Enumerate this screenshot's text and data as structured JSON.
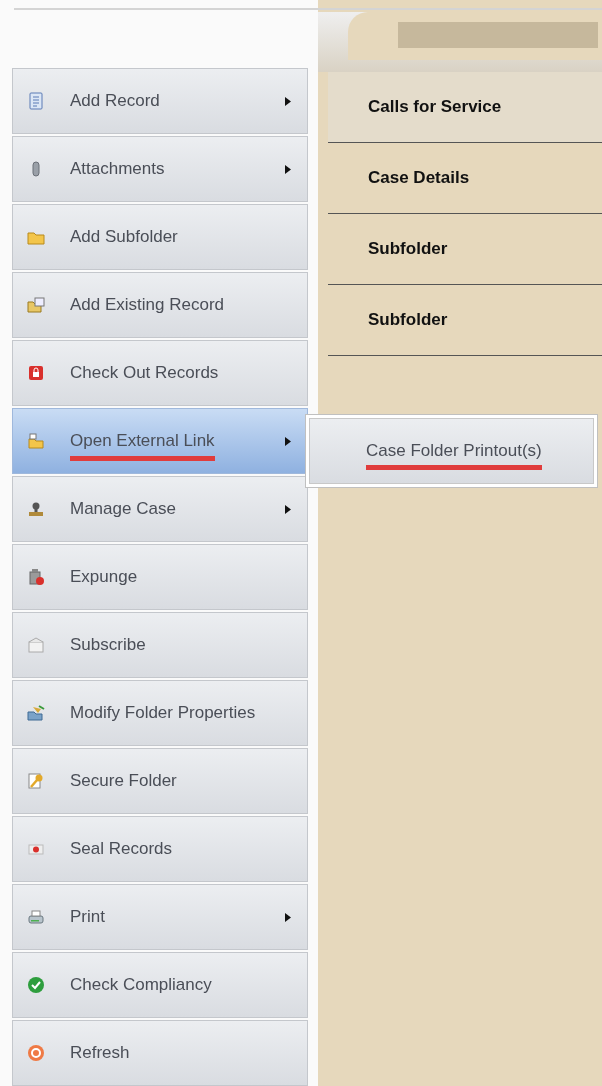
{
  "menu": [
    {
      "label": "Add Record",
      "has_submenu": true,
      "selected": false,
      "underlined": false
    },
    {
      "label": "Attachments",
      "has_submenu": true,
      "selected": false,
      "underlined": false
    },
    {
      "label": "Add Subfolder",
      "has_submenu": false,
      "selected": false,
      "underlined": false
    },
    {
      "label": "Add Existing Record",
      "has_submenu": false,
      "selected": false,
      "underlined": false
    },
    {
      "label": "Check Out Records",
      "has_submenu": false,
      "selected": false,
      "underlined": false
    },
    {
      "label": "Open External Link",
      "has_submenu": true,
      "selected": true,
      "underlined": true
    },
    {
      "label": "Manage Case",
      "has_submenu": true,
      "selected": false,
      "underlined": false
    },
    {
      "label": "Expunge",
      "has_submenu": false,
      "selected": false,
      "underlined": false
    },
    {
      "label": "Subscribe",
      "has_submenu": false,
      "selected": false,
      "underlined": false
    },
    {
      "label": "Modify Folder Properties",
      "has_submenu": false,
      "selected": false,
      "underlined": false
    },
    {
      "label": "Secure Folder",
      "has_submenu": false,
      "selected": false,
      "underlined": false
    },
    {
      "label": "Seal Records",
      "has_submenu": false,
      "selected": false,
      "underlined": false
    },
    {
      "label": "Print",
      "has_submenu": true,
      "selected": false,
      "underlined": false
    },
    {
      "label": "Check Compliancy",
      "has_submenu": false,
      "selected": false,
      "underlined": false
    },
    {
      "label": "Refresh",
      "has_submenu": false,
      "selected": false,
      "underlined": false
    }
  ],
  "submenu": [
    {
      "label": "Case Folder Printout(s)",
      "underlined": true
    }
  ],
  "folder_sections": [
    {
      "label": "Calls for Service",
      "selected": true
    },
    {
      "label": "Case Details",
      "selected": false
    },
    {
      "label": "Subfolder",
      "selected": false
    },
    {
      "label": "Subfolder",
      "selected": false
    }
  ]
}
